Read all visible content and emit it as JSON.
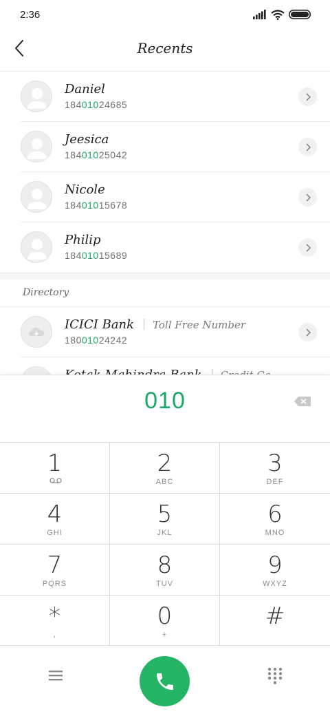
{
  "status_bar": {
    "time": "2:36"
  },
  "header": {
    "title": "Recents"
  },
  "recents": [
    {
      "name": "Daniel",
      "number_prefix": "184",
      "number_match": "010",
      "number_suffix": "24685"
    },
    {
      "name": "Jeesica",
      "number_prefix": "184",
      "number_match": "010",
      "number_suffix": "25042"
    },
    {
      "name": "Nicole",
      "number_prefix": "184",
      "number_match": "010",
      "number_suffix": "15678"
    },
    {
      "name": "Philip",
      "number_prefix": "184",
      "number_match": "010",
      "number_suffix": "15689"
    }
  ],
  "directory": {
    "label": "Directory",
    "items": [
      {
        "name": "ICICI Bank",
        "tag": "Toll Free Number",
        "number_prefix": "180",
        "number_match": "010",
        "number_suffix": "24242"
      },
      {
        "name": "Kotak Mahindra Bank",
        "tag": "Credit Ca",
        "number_prefix": "",
        "number_match": "",
        "number_suffix": ""
      }
    ]
  },
  "dialer": {
    "input": "010",
    "keys": [
      {
        "digit": "1",
        "letters": ""
      },
      {
        "digit": "2",
        "letters": "ABC"
      },
      {
        "digit": "3",
        "letters": "DEF"
      },
      {
        "digit": "4",
        "letters": "GHI"
      },
      {
        "digit": "5",
        "letters": "JKL"
      },
      {
        "digit": "6",
        "letters": "MNO"
      },
      {
        "digit": "7",
        "letters": "PQRS"
      },
      {
        "digit": "8",
        "letters": "TUV"
      },
      {
        "digit": "9",
        "letters": "WXYZ"
      },
      {
        "digit": "*",
        "letters": ","
      },
      {
        "digit": "0",
        "letters": "+"
      },
      {
        "digit": "#",
        "letters": ""
      }
    ]
  },
  "colors": {
    "accent": "#1aa866",
    "call_button": "#23b565"
  },
  "icons": [
    "signal-icon",
    "wifi-icon",
    "battery-icon",
    "back-icon",
    "avatar-icon",
    "chevron-right-icon",
    "cloud-icon",
    "backspace-icon",
    "voicemail-icon",
    "menu-icon",
    "phone-icon",
    "keypad-icon"
  ]
}
